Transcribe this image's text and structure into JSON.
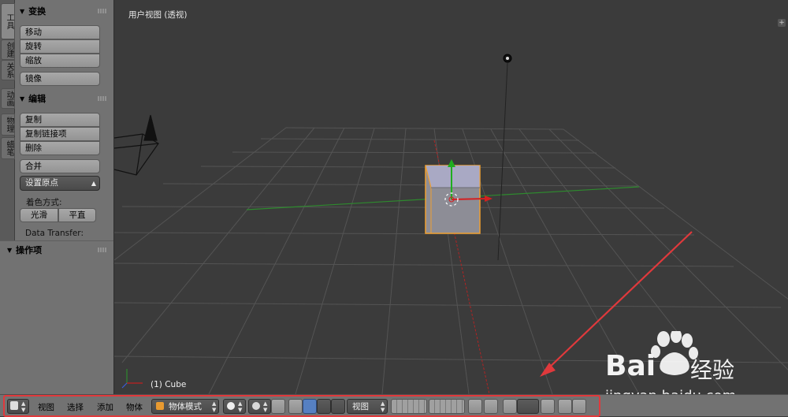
{
  "tabs": [
    "工具",
    "创建",
    "关系",
    "动画",
    "物理",
    "蜡笔"
  ],
  "transform_panel": {
    "title": "变换",
    "buttons": [
      "移动",
      "旋转",
      "缩放",
      "镜像"
    ]
  },
  "edit_panel": {
    "title": "编辑",
    "buttons": [
      "复制",
      "复制链接项",
      "删除",
      "合并"
    ],
    "set_origin": "设置原点",
    "shading_label": "着色方式:",
    "smooth": "光滑",
    "flat": "平直",
    "data_transfer": "Data Transfer:"
  },
  "operator_panel": {
    "title": "操作项"
  },
  "viewport": {
    "title": "用户视图 (透视)",
    "object_label": "(1) Cube"
  },
  "header": {
    "menus": [
      "视图",
      "选择",
      "添加",
      "物体"
    ],
    "mode": "物体模式",
    "orientation": "视图"
  },
  "watermark": {
    "brand": "Bai",
    "brand2": "经验",
    "url": "jingyan.baidu.com"
  },
  "colors": {
    "highlight": "#e0393c",
    "x_axis": "#c02020",
    "y_axis": "#2e8a2e",
    "selection": "#f0a030"
  }
}
